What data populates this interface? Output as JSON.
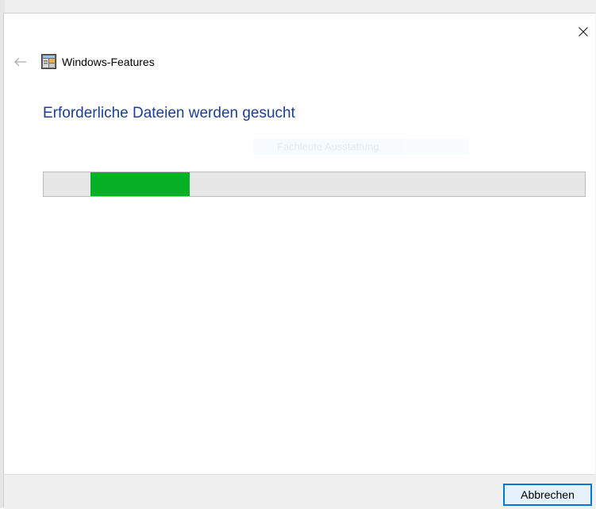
{
  "window": {
    "title": "Windows-Features",
    "icon": "windows-features-icon"
  },
  "main": {
    "heading": "Erforderliche Dateien werden gesucht",
    "ghost_text": "Fachleute Ausstattung"
  },
  "progress": {
    "indeterminate": true,
    "segment_start": 0.086,
    "segment_end": 0.27,
    "fill_color": "#06b025"
  },
  "footer": {
    "cancel_label": "Abbrechen"
  },
  "colors": {
    "heading": "#1c3f94",
    "button_border": "#0078d7",
    "button_bg": "#e5f1fb"
  }
}
